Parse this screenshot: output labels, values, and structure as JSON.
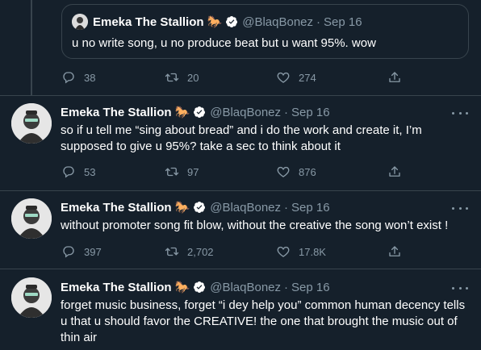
{
  "quote": {
    "name": "Emeka The Stallion",
    "emoji": "🐎",
    "handle": "@BlaqBonez",
    "dot": "·",
    "date": "Sep 16",
    "text": "u no write song, u no produce beat but u want 95%. wow",
    "replies": "38",
    "retweets": "20",
    "likes": "274"
  },
  "tweets": [
    {
      "name": "Emeka The Stallion",
      "emoji": "🐎",
      "handle": "@BlaqBonez",
      "dot": "·",
      "date": "Sep 16",
      "text": "so if u tell me “sing about bread” and i do the work and create it, I’m supposed to give u 95%? take a sec to think about it",
      "replies": "53",
      "retweets": "97",
      "likes": "876"
    },
    {
      "name": "Emeka The Stallion",
      "emoji": "🐎",
      "handle": "@BlaqBonez",
      "dot": "·",
      "date": "Sep 16",
      "text": "without promoter song fit blow, without the creative the song won’t exist !",
      "replies": "397",
      "retweets": "2,702",
      "likes": "17.8K"
    },
    {
      "name": "Emeka The Stallion",
      "emoji": "🐎",
      "handle": "@BlaqBonez",
      "dot": "·",
      "date": "Sep 16",
      "text": "forget music business, forget “i dey help you” common human decency tells u that u should favor the CREATIVE! the one that brought the music out of thin air"
    }
  ],
  "colors": {
    "background": "#15202b",
    "border": "#38444d",
    "muted": "#8899a6",
    "verified": "#ffffff"
  },
  "icons": [
    "reply-icon",
    "retweet-icon",
    "like-icon",
    "share-icon",
    "verified-icon",
    "more-icon"
  ]
}
